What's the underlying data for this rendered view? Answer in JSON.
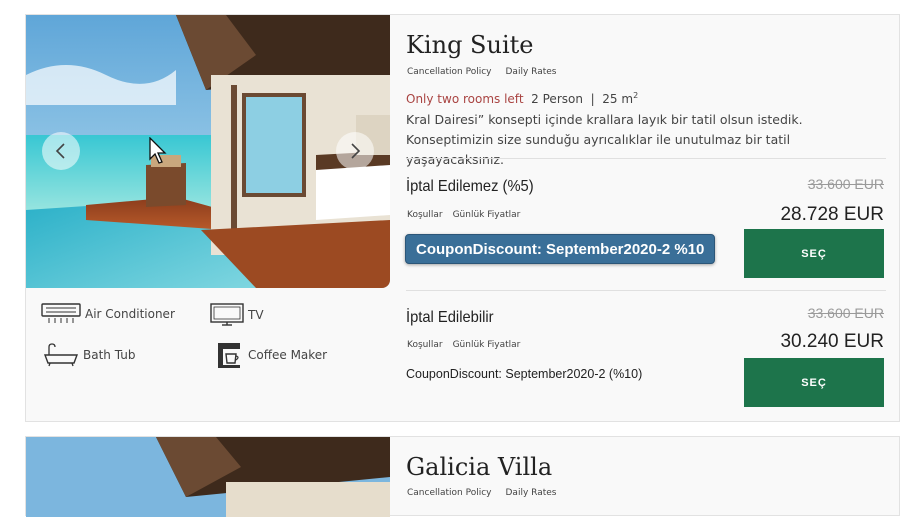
{
  "rooms": [
    {
      "name": "King Suite",
      "links": {
        "cancellation": "Cancellation Policy",
        "daily": "Daily Rates"
      },
      "availability": "Only two rooms left",
      "capacity": "2 Person",
      "separator": "|",
      "size": "25 m",
      "size_sup": "2",
      "description": "Kral Dairesi” konsepti içinde krallara layık bir tatil olsun istedik. Konseptimizin size sunduğu ayrıcalıklar ile unutulmaz bir tatil yaşayacaksınız.",
      "amenities": [
        {
          "label": "Air Conditioner",
          "icon": "air-conditioner-icon"
        },
        {
          "label": "TV",
          "icon": "tv-icon"
        },
        {
          "label": "Bath Tub",
          "icon": "bath-tub-icon"
        },
        {
          "label": "Coffee Maker",
          "icon": "coffee-maker-icon"
        }
      ],
      "rates": [
        {
          "name": "İptal Edilemez (%5)",
          "link_conditions": "Koşullar",
          "link_daily": "Günlük Fiyatlar",
          "old_price": "33.600 EUR",
          "price": "28.728 EUR",
          "coupon": "CouponDiscount: September2020-2 %10",
          "button": "SEÇ"
        },
        {
          "name": "İptal Edilebilir",
          "link_conditions": "Koşullar",
          "link_daily": "Günlük Fiyatlar",
          "old_price": "33.600 EUR",
          "price": "30.240 EUR",
          "coupon": "CouponDiscount: September2020-2 (%10)",
          "button": "SEÇ"
        }
      ]
    },
    {
      "name": "Galicia Villa",
      "links": {
        "cancellation": "Cancellation Policy",
        "daily": "Daily Rates"
      }
    }
  ],
  "colors": {
    "button": "#1d744b",
    "coupon_badge": "#3a6f98",
    "availability": "#a94442"
  }
}
